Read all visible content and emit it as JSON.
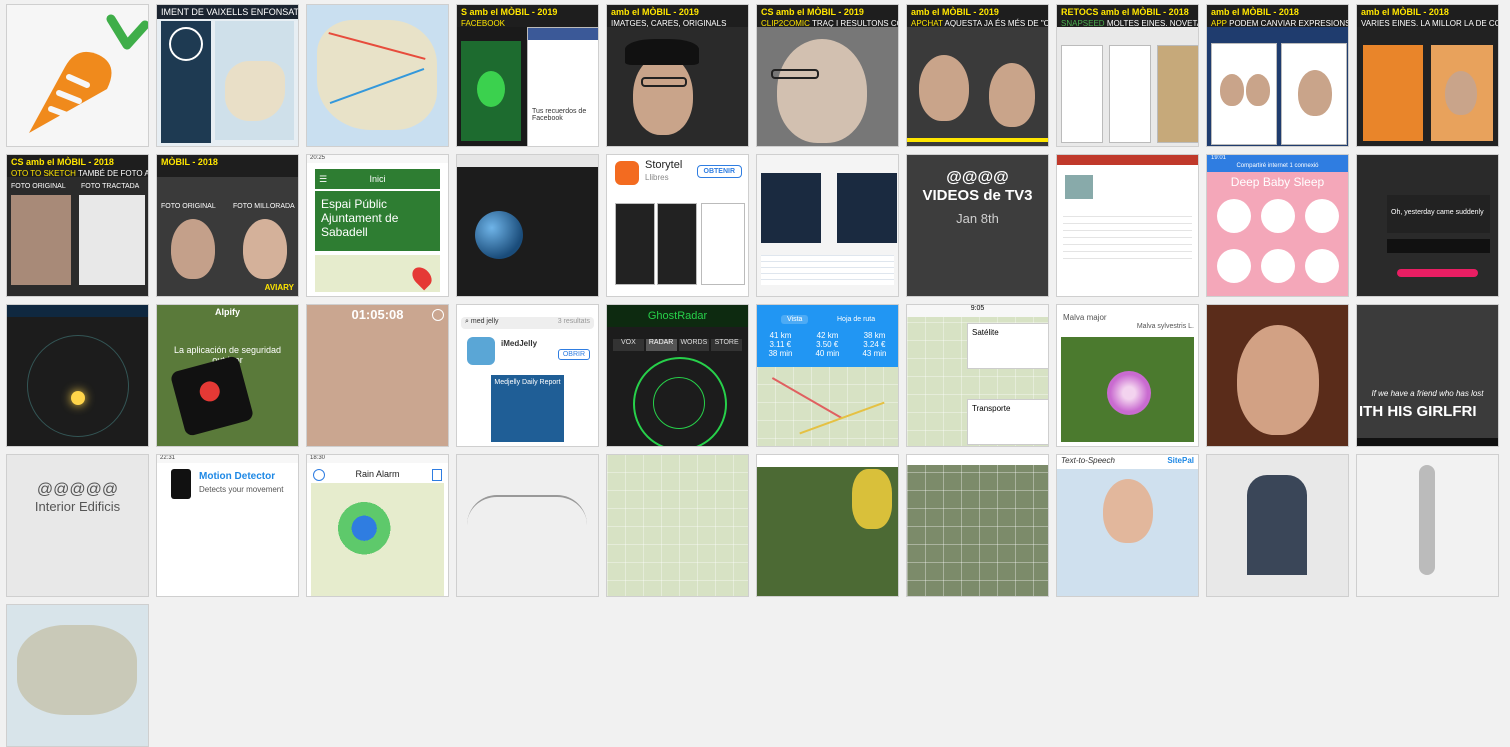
{
  "tiles_row1": {
    "vaixells": "IMENT DE VAIXELLS ENFONSATS",
    "fb_title": "S amb el MÒBIL - 2019",
    "fb_sub": "FACEBOOK",
    "fb_caption": "Tus recuerdos de Facebook",
    "imatges_title": "amb el MÒBIL - 2019",
    "imatges_sub": "IMATGES, CARES, ORIGINALS",
    "clip_title": "CS amb el MÒBIL - 2019",
    "clip_sub": "CLIP2COMIC",
    "clip_text": "TRAÇ I RESULTONS COLORS",
    "snap_title": "amb el MÒBIL - 2019",
    "snap_sub": "APCHAT",
    "snap_text": "AQUESTA JA ÉS MÉS DE \"CREACIÓ\"",
    "retocs_title": "RETOCS amb el MÒBIL - 2018",
    "retocs_sub": "SNAPSEED",
    "retocs_text": "MOLTES EINES. NOVETAT: O BORRADOR.",
    "faceapp_title": "amb el MÒBIL - 2018",
    "faceapp_sub": "APP",
    "faceapp_text": "PODEM CANVIAR EXPRESIONS DE LA CA",
    "last_title": "amb el MÒBIL - 2018",
    "last_text": "VARIES EINES. LA MILLOR LA DE COLOREJA UNA PART DE LA IMATGE."
  },
  "tiles_row2": {
    "sketch_title": "CS amb el MÒBIL - 2018",
    "sketch_sub": "OTO TO SKETCH",
    "sketch_text": "TAMBÉ DE FOTO A DIBUIX",
    "sketch_l1": "FOTO ORIGINAL",
    "sketch_l2": "FOTO TRACTADA",
    "aviary_title": "MÒBIL - 2018",
    "aviary_l1": "FOTO ORIGINAL",
    "aviary_l2": "FOTO MILLORADA",
    "aviary_l3": "AVIARY",
    "espai_status_time": "20:25",
    "espai_nav": "Inici",
    "espai_title": "Espai Públic Ajuntament de Sabadell",
    "storytel_name": "Storytel",
    "storytel_sub": "Llibres",
    "storytel_button": "OBTENIR",
    "tv3_line1": "@@@@",
    "tv3_line2": "VIDEOS de TV3",
    "tv3_line3": "Jan 8th",
    "baby_title": "Deep Baby Sleep",
    "baby_status": "19:01",
    "baby_banner": "Compartiré internet 1 connexió",
    "music_text": "Oh, yesterday came suddenly"
  },
  "tiles_row3": {
    "alpify_brand": "Alpify",
    "alpify_text": "La aplicación de seguridad outdoor",
    "timer": "01:05:08",
    "med_search": "med jelly",
    "med_results": "3 resultats",
    "med_app": "iMedJelly",
    "med_button": "OBRIR",
    "med_report": "Medjelly Daily Report",
    "ghost_title": "GhostRadar",
    "ghost_tabs": [
      "VOX",
      "RADAR",
      "WORDS",
      "STORE"
    ],
    "route_tabs": [
      "Vista",
      "Hoja de ruta"
    ],
    "route_rows": [
      [
        "41 km",
        "42 km",
        "38 km"
      ],
      [
        "3.11 €",
        "3.50 €",
        "3.24 €"
      ],
      [
        "38 min",
        "40 min",
        "43 min"
      ]
    ],
    "layers_time": "9:05",
    "layers_sat": "Satélite",
    "layers_transport": "Transporte",
    "malva_l1": "Malva major",
    "malva_l2": "Malva sylvestris L.",
    "film_line1": "If we have a friend who has lost",
    "film_line2": "ITH HIS GIRLFRI"
  },
  "tiles_row4": {
    "interior_l1": "@@@@@",
    "interior_l2": "Interior Edificis",
    "motion_time": "22:31",
    "motion_title": "Motion Detector",
    "motion_sub": "Detects your movement",
    "rain_time": "18:30",
    "rain_title": "Rain Alarm",
    "tts_title": "Text-to-Speech",
    "tts_brand": "SitePal"
  },
  "colors": {
    "accent": "#ffe600",
    "carrot": "#f08a1c",
    "leaf": "#3fae49",
    "espai_green": "#2e7d32",
    "baby_pink": "#f4a7b9",
    "route_blue": "#2196f3",
    "ghost_green": "#27d04a"
  }
}
